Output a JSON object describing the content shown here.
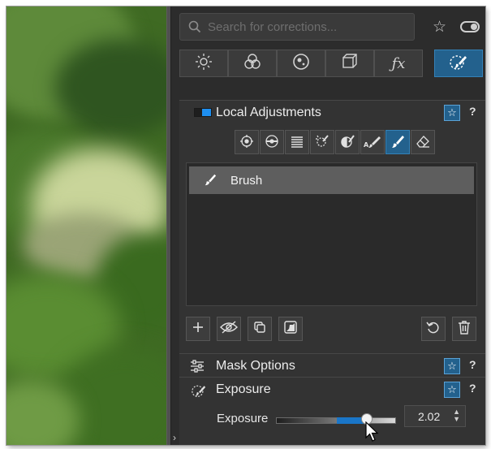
{
  "search": {
    "placeholder": "Search for corrections..."
  },
  "tool_tabs": [
    {
      "icon": "sun-icon"
    },
    {
      "icon": "color-circles-icon"
    },
    {
      "icon": "lens-icon"
    },
    {
      "icon": "cube-icon"
    },
    {
      "icon": "fx-icon",
      "glyph": "ƒx"
    },
    {
      "icon": "local-brush-icon",
      "active": true
    }
  ],
  "local_adjustments": {
    "title": "Local Adjustments",
    "help": "?",
    "list_items": [
      {
        "label": "Brush"
      }
    ]
  },
  "mask_options": {
    "title": "Mask Options",
    "help": "?"
  },
  "exposure_section": {
    "title": "Exposure",
    "help": "?",
    "slider": {
      "label": "Exposure",
      "value": "2.02",
      "position_fraction": 0.76
    }
  },
  "colors": {
    "accent": "#23618d",
    "panel": "#2c2c2c",
    "slider_fill": "#1a76c8"
  }
}
